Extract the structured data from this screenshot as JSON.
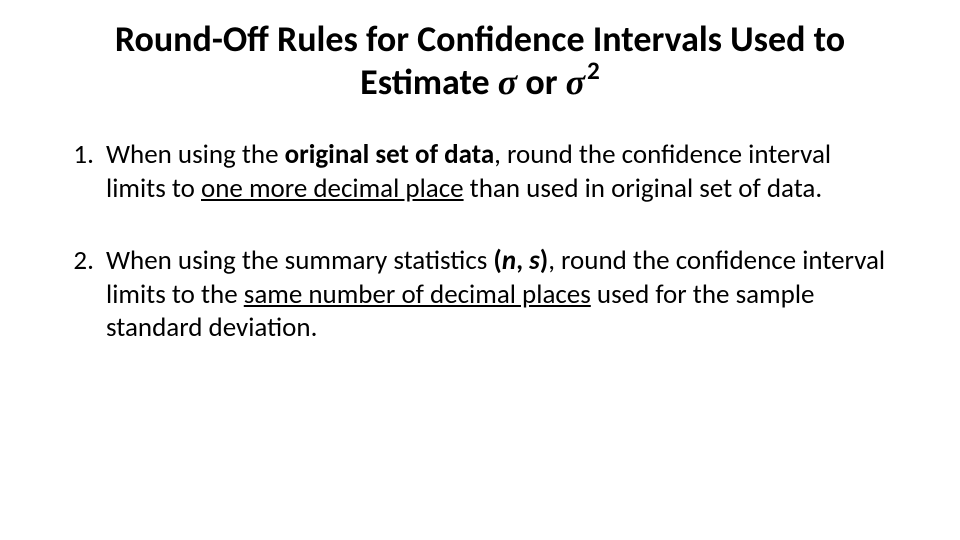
{
  "title": {
    "line1": "Round-Off Rules for Confidence Intervals Used to",
    "line2_pre": "Estimate ",
    "sigma": "σ",
    "line2_mid": " or ",
    "square": "2"
  },
  "items": {
    "i1": {
      "t1": "When using the ",
      "bold1": "original set of data",
      "t2": ", round the confidence interval limits to ",
      "u1": "one more decimal place",
      "t3": " than used in original set of data."
    },
    "i2": {
      "t1": "When using the summary statistics ",
      "paren_open": "(",
      "n": "n",
      "comma": ", ",
      "s": "s",
      "paren_close": ")",
      "t2": ", round the confidence interval limits to the ",
      "u1": "same number of decimal places",
      "t3": " used for the sample standard deviation."
    }
  }
}
